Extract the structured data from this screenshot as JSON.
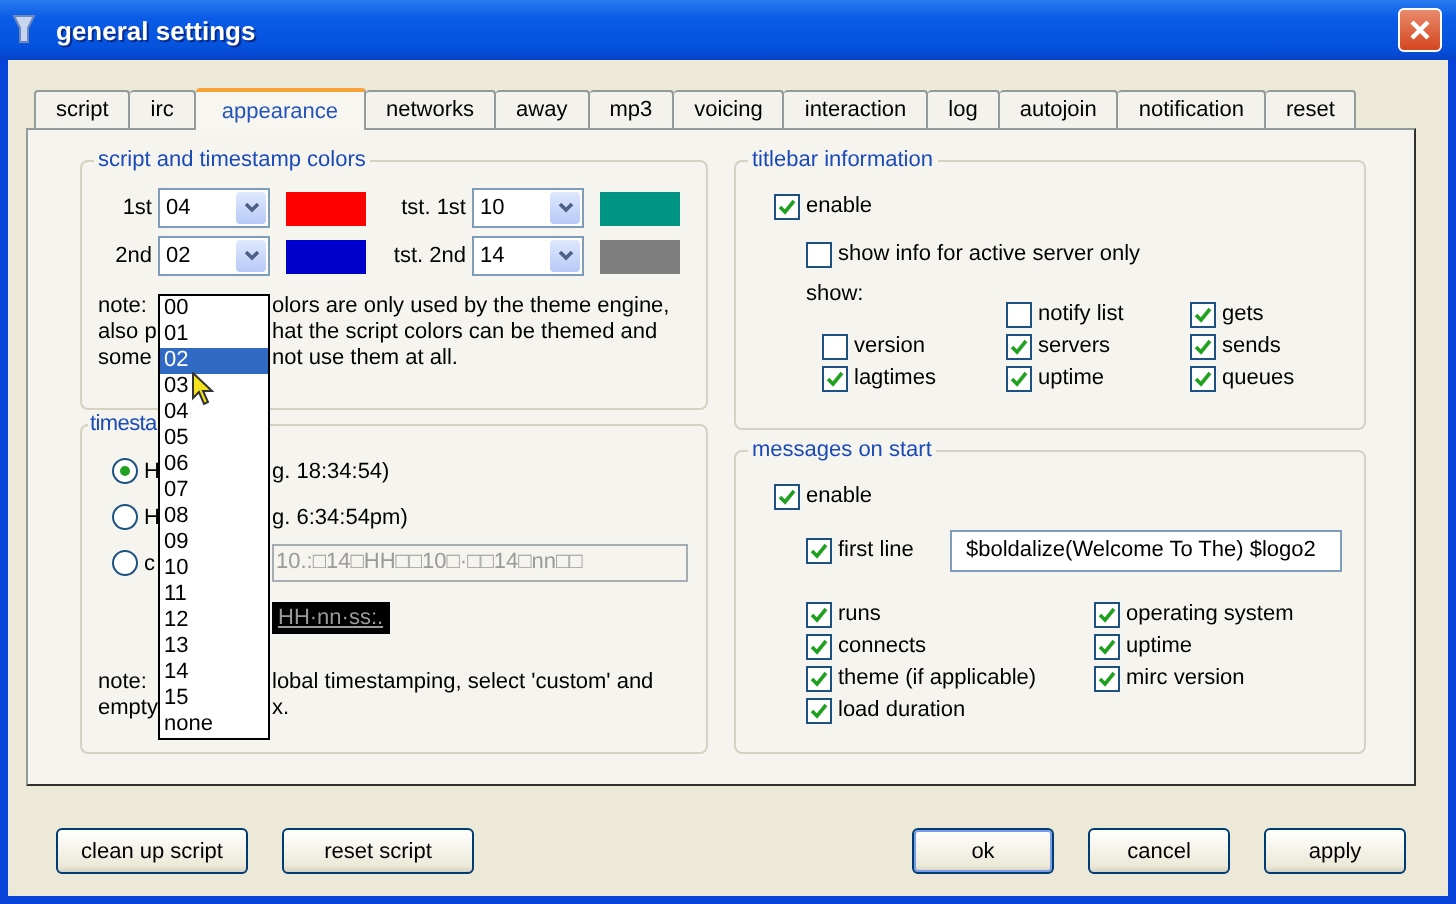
{
  "window": {
    "title": "general settings"
  },
  "tabs": [
    {
      "label": "script",
      "selected": false
    },
    {
      "label": "irc",
      "selected": false
    },
    {
      "label": "appearance",
      "selected": true
    },
    {
      "label": "networks",
      "selected": false
    },
    {
      "label": "away",
      "selected": false
    },
    {
      "label": "mp3",
      "selected": false
    },
    {
      "label": "voicing",
      "selected": false
    },
    {
      "label": "interaction",
      "selected": false
    },
    {
      "label": "log",
      "selected": false
    },
    {
      "label": "autojoin",
      "selected": false
    },
    {
      "label": "notification",
      "selected": false
    },
    {
      "label": "reset",
      "selected": false
    }
  ],
  "script_colors": {
    "title": "script and timestamp colors",
    "pickers": [
      {
        "label": "1st",
        "value": "04",
        "color": "#ff0000"
      },
      {
        "label": "tst. 1st",
        "value": "10",
        "color": "#009485"
      },
      {
        "label": "2nd",
        "value": "02",
        "color": "#0000cc"
      },
      {
        "label": "tst. 2nd",
        "value": "14",
        "color": "#7f7f7f"
      }
    ],
    "note_lines": [
      {
        "left": "note:",
        "right": "olors are only used by the theme engine,"
      },
      {
        "left": "also p",
        "right": "hat the script colors can be themed and"
      },
      {
        "left": "some",
        "right": "not use them at all."
      }
    ]
  },
  "timestamps": {
    "title": "timesta",
    "options": [
      {
        "left": "H",
        "right": "g. 18:34:54)",
        "selected": true
      },
      {
        "left": "H",
        "right": "g. 6:34:54pm)",
        "selected": false
      },
      {
        "left": "c",
        "selected": false
      }
    ],
    "custom_value": "10.:□14□HH□□10□·□□14□nn□□",
    "preview": "HH·nn·ss:.",
    "note_lines": [
      {
        "left": "note:",
        "right": "lobal timestamping, select 'custom' and"
      },
      {
        "left": "empty",
        "right": "x."
      }
    ]
  },
  "dropdown": {
    "options": [
      {
        "label": "00",
        "selected": false
      },
      {
        "label": "01",
        "selected": false
      },
      {
        "label": "02",
        "selected": true
      },
      {
        "label": "03",
        "selected": false
      },
      {
        "label": "04",
        "selected": false
      },
      {
        "label": "05",
        "selected": false
      },
      {
        "label": "06",
        "selected": false
      },
      {
        "label": "07",
        "selected": false
      },
      {
        "label": "08",
        "selected": false
      },
      {
        "label": "09",
        "selected": false
      },
      {
        "label": "10",
        "selected": false
      },
      {
        "label": "11",
        "selected": false
      },
      {
        "label": "12",
        "selected": false
      },
      {
        "label": "13",
        "selected": false
      },
      {
        "label": "14",
        "selected": false
      },
      {
        "label": "15",
        "selected": false
      },
      {
        "label": "none",
        "selected": false
      }
    ]
  },
  "titlebar": {
    "title": "titlebar information",
    "enable": {
      "label": "enable",
      "checked": true
    },
    "active_only": {
      "label": "show info for active server only",
      "checked": false
    },
    "show_label": "show:",
    "columns": [
      {
        "items": [
          {
            "label": "version",
            "checked": false
          },
          {
            "label": "lagtimes",
            "checked": true
          }
        ]
      },
      {
        "items": [
          {
            "label": "notify list",
            "checked": false
          },
          {
            "label": "servers",
            "checked": true
          },
          {
            "label": "uptime",
            "checked": true
          }
        ]
      },
      {
        "items": [
          {
            "label": "gets",
            "checked": true
          },
          {
            "label": "sends",
            "checked": true
          },
          {
            "label": "queues",
            "checked": true
          }
        ]
      }
    ]
  },
  "messages": {
    "title": "messages on start",
    "enable": {
      "label": "enable",
      "checked": true
    },
    "first_line": {
      "label": "first line",
      "checked": true,
      "value": "$boldalize(Welcome To The) $logo2"
    },
    "columns": [
      {
        "items": [
          {
            "label": "runs",
            "checked": true
          },
          {
            "label": "connects",
            "checked": true
          },
          {
            "label": "theme (if applicable)",
            "checked": true
          },
          {
            "label": "load duration",
            "checked": true
          }
        ]
      },
      {
        "items": [
          {
            "label": "operating system",
            "checked": true
          },
          {
            "label": "uptime",
            "checked": true
          },
          {
            "label": "mirc version",
            "checked": true
          }
        ]
      }
    ]
  },
  "buttons_left": [
    "clean up script",
    "reset script"
  ],
  "buttons_right": [
    {
      "label": "ok",
      "default": true
    },
    {
      "label": "cancel",
      "default": false
    },
    {
      "label": "apply",
      "default": false
    }
  ]
}
